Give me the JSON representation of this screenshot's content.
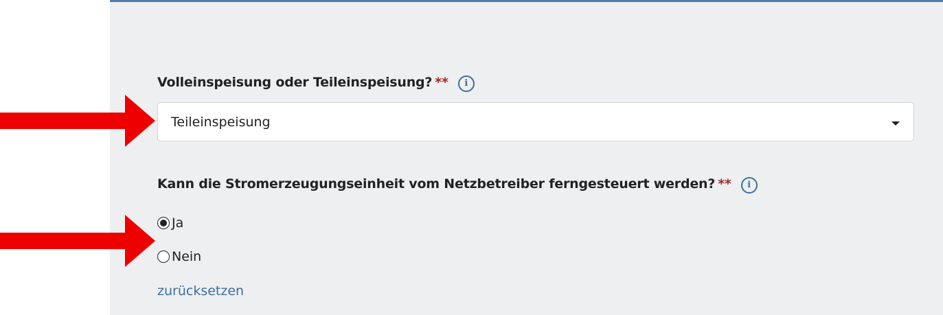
{
  "field_einspeisung": {
    "label": "Volleinspeisung oder Teileinspeisung?",
    "required_marker": "**",
    "info_icon": "info-icon",
    "selected_value": "Teileinspeisung"
  },
  "field_fernsteuerung": {
    "label": "Kann die Stromerzeugungseinheit vom Netzbetreiber ferngesteuert werden?",
    "required_marker": "**",
    "info_icon": "info-icon",
    "options": [
      {
        "label": "Ja",
        "checked": true
      },
      {
        "label": "Nein",
        "checked": false
      }
    ],
    "reset_label": "zurücksetzen"
  },
  "annotations": {
    "arrow_color": "#ee0000",
    "arrows": [
      "arrow-right-icon",
      "arrow-right-icon"
    ]
  },
  "colors": {
    "panel_background": "#eeeff0",
    "accent": "#3d6ea0",
    "required": "#9b2b2b"
  }
}
